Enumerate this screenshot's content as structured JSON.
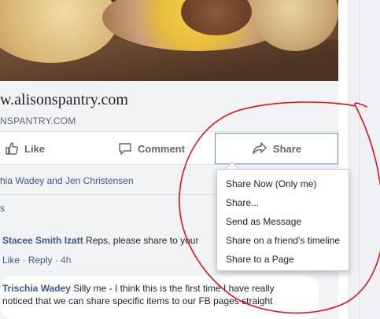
{
  "link_preview": {
    "title": "w.alisonspantry.com",
    "domain": "NSPANTRY.COM"
  },
  "actions": {
    "like": "Like",
    "comment": "Comment",
    "share": "Share"
  },
  "reactions": {
    "names": "hia Wadey and Jen Christensen",
    "more": "s"
  },
  "share_menu": {
    "items": [
      "Share Now (Only me)",
      "Share...",
      "Send as Message",
      "Share on a friend's timeline",
      "Share to a Page"
    ]
  },
  "comments": [
    {
      "author": "Stacee Smith Izatt",
      "text": " Reps, please share to your",
      "like": "Like",
      "reply": "Reply",
      "time": "4h"
    },
    {
      "author": "Trischia Wadey",
      "text": " Silly me - I think this is the first time I have really",
      "text2": "noticed that we can share specific items to our FB pages straight"
    }
  ],
  "colors": {
    "link": "#385898",
    "share_outline": "#5b8fe0",
    "annotation": "#e8101a"
  }
}
